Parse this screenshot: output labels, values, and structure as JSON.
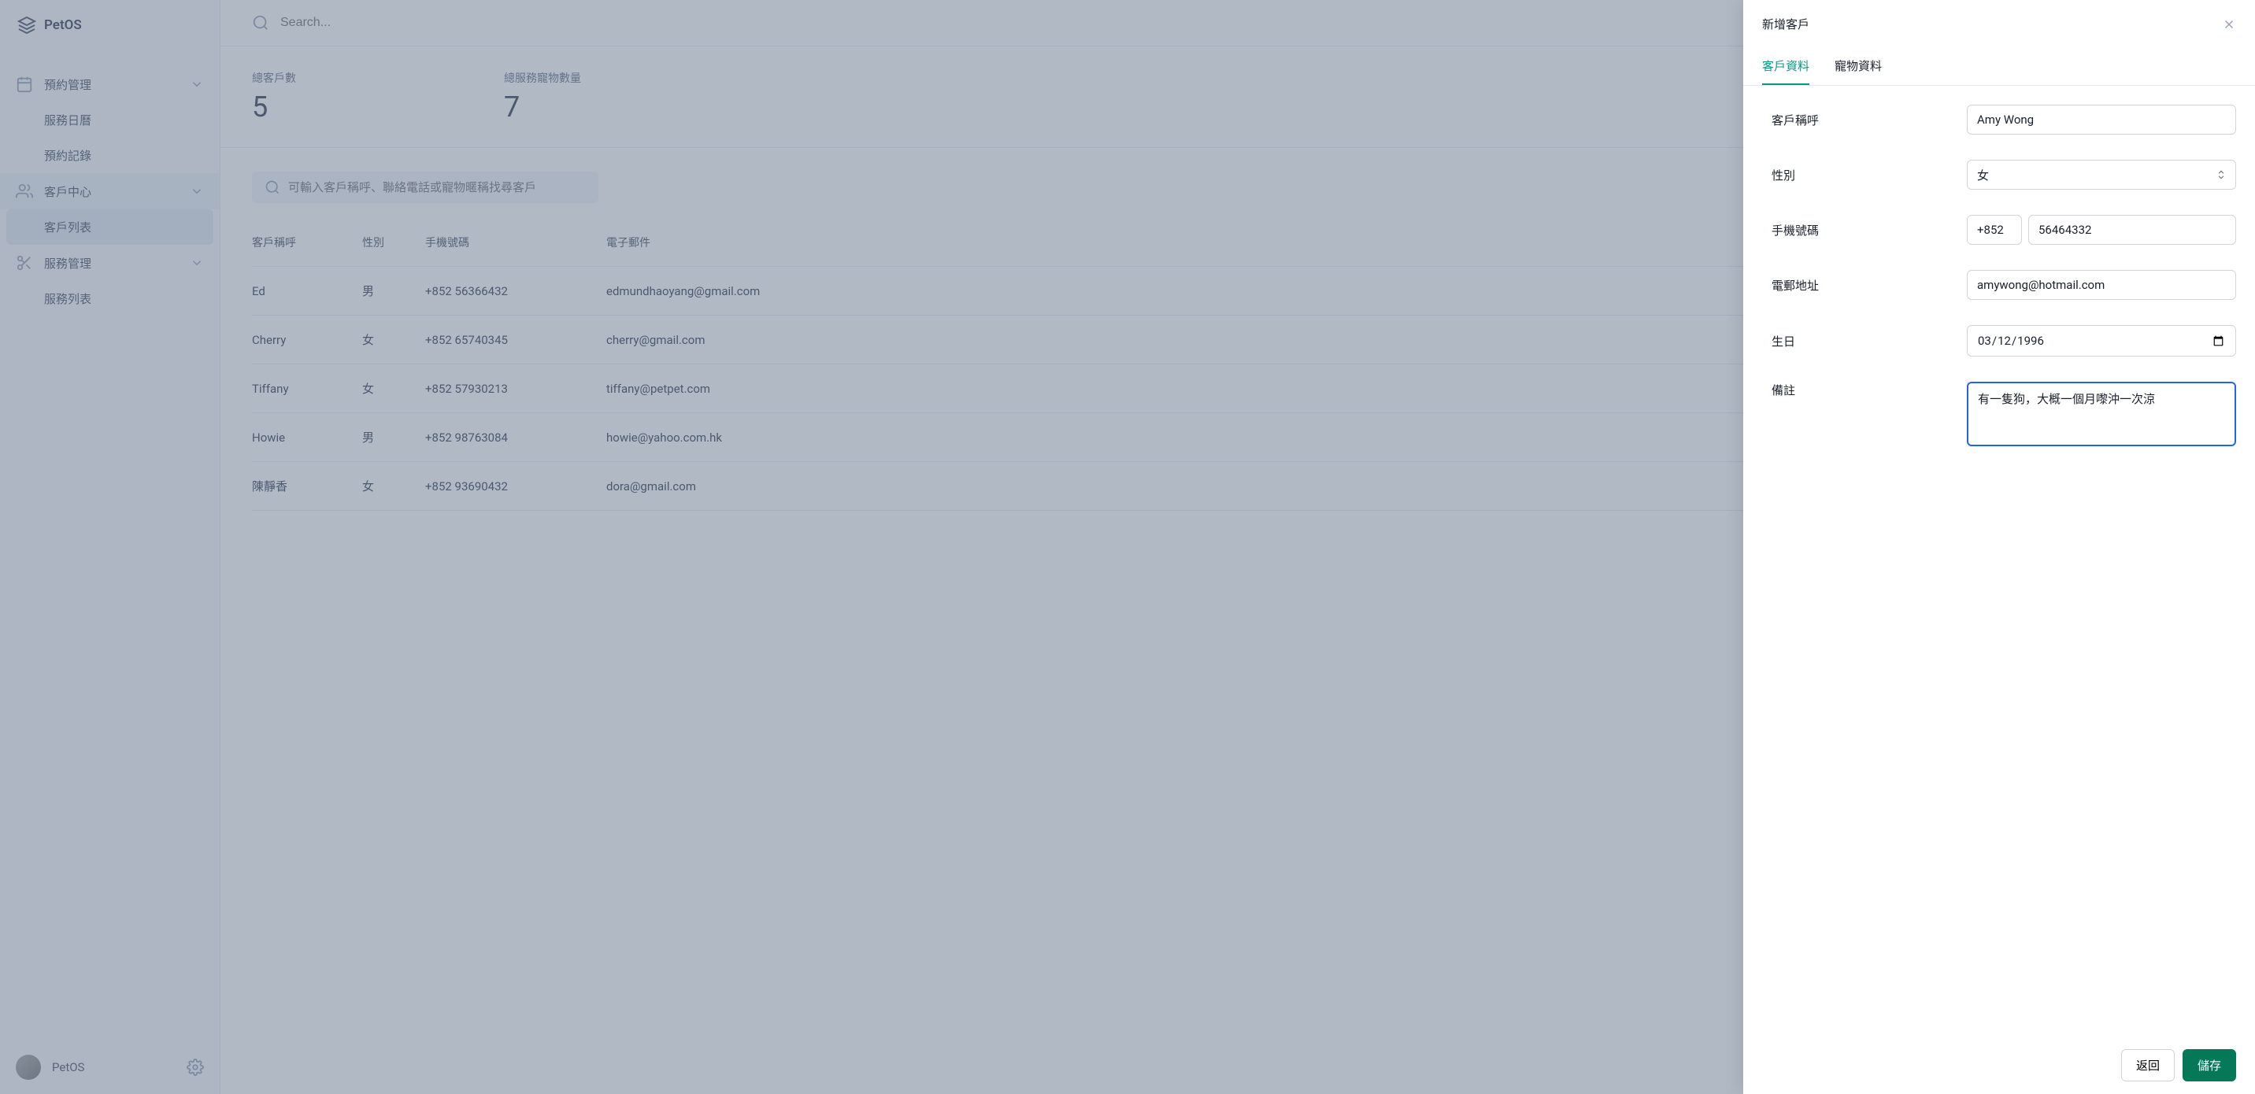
{
  "app": {
    "name": "PetOS",
    "search_placeholder": "Search..."
  },
  "sidebar": {
    "groups": [
      {
        "label": "預約管理",
        "items": [
          "服務日曆",
          "預約記錄"
        ]
      },
      {
        "label": "客戶中心",
        "items": [
          "客戶列表"
        ]
      },
      {
        "label": "服務管理",
        "items": [
          "服務列表"
        ]
      }
    ],
    "footer_name": "PetOS"
  },
  "stats": [
    {
      "label": "總客戶數",
      "value": "5"
    },
    {
      "label": "總服務寵物數量",
      "value": "7"
    }
  ],
  "filter_placeholder": "可輸入客戶稱呼、聯絡電話或寵物暱稱找尋客戶",
  "table": {
    "headers": [
      "客戶稱呼",
      "性別",
      "手機號碼",
      "電子郵件"
    ],
    "rows": [
      {
        "name": "Ed",
        "gender": "男",
        "phone": "+852 56366432",
        "email": "edmundhaoyang@gmail.com"
      },
      {
        "name": "Cherry",
        "gender": "女",
        "phone": "+852 65740345",
        "email": "cherry@gmail.com"
      },
      {
        "name": "Tiffany",
        "gender": "女",
        "phone": "+852 57930213",
        "email": "tiffany@petpet.com"
      },
      {
        "name": "Howie",
        "gender": "男",
        "phone": "+852 98763084",
        "email": "howie@yahoo.com.hk"
      },
      {
        "name": "陳靜香",
        "gender": "女",
        "phone": "+852 93690432",
        "email": "dora@gmail.com"
      }
    ]
  },
  "drawer": {
    "title": "新增客戶",
    "tabs": [
      "客戶資料",
      "寵物資料"
    ],
    "fields": {
      "name_label": "客戶稱呼",
      "name_value": "Amy Wong",
      "gender_label": "性別",
      "gender_value": "女",
      "phone_label": "手機號碼",
      "phone_prefix": "+852",
      "phone_value": "56464332",
      "email_label": "電郵地址",
      "email_value": "amywong@hotmail.com",
      "birthday_label": "生日",
      "birthday_value": "1996-03-12",
      "notes_label": "備註",
      "notes_value": "有一隻狗，大概一個月嚟沖一次涼"
    },
    "back_button": "返回",
    "save_button": "儲存"
  }
}
